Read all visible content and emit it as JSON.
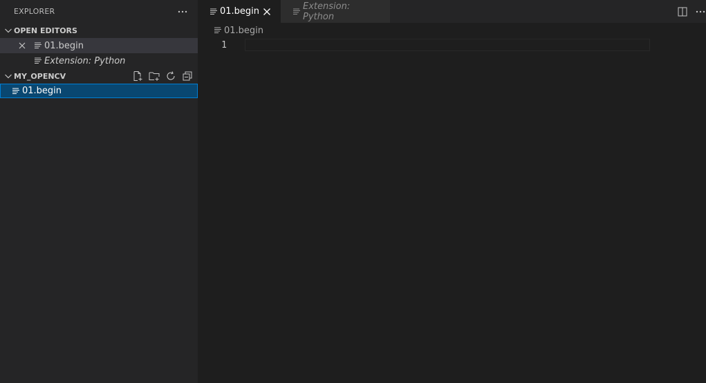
{
  "sidebar": {
    "title": "EXPLORER",
    "more_label": "···",
    "open_editors": {
      "header": "OPEN EDITORS",
      "items": [
        {
          "label": "01.begin",
          "italic": false,
          "has_close": true
        },
        {
          "label": "Extension: Python",
          "italic": true,
          "has_close": false
        }
      ]
    },
    "workspace": {
      "header": "MY_OPENCV",
      "actions": [
        "new-file-icon",
        "new-folder-icon",
        "refresh-icon",
        "collapse-all-icon"
      ],
      "files": [
        {
          "label": "01.begin"
        }
      ]
    }
  },
  "editor": {
    "tabs": [
      {
        "label": "01.begin",
        "active": true
      },
      {
        "label": "Extension: Python",
        "active": false
      }
    ],
    "actions": [
      "split-editor-icon",
      "more-actions-icon"
    ],
    "more_label": "···",
    "breadcrumb": "01.begin",
    "lines": [
      {
        "number": "1",
        "text": ""
      }
    ]
  },
  "colors": {
    "sidebar_bg": "#252526",
    "editor_bg": "#1e1e1e",
    "selection_bg": "#094771",
    "selection_border": "#007fd4",
    "active_row_bg": "#37373d"
  }
}
